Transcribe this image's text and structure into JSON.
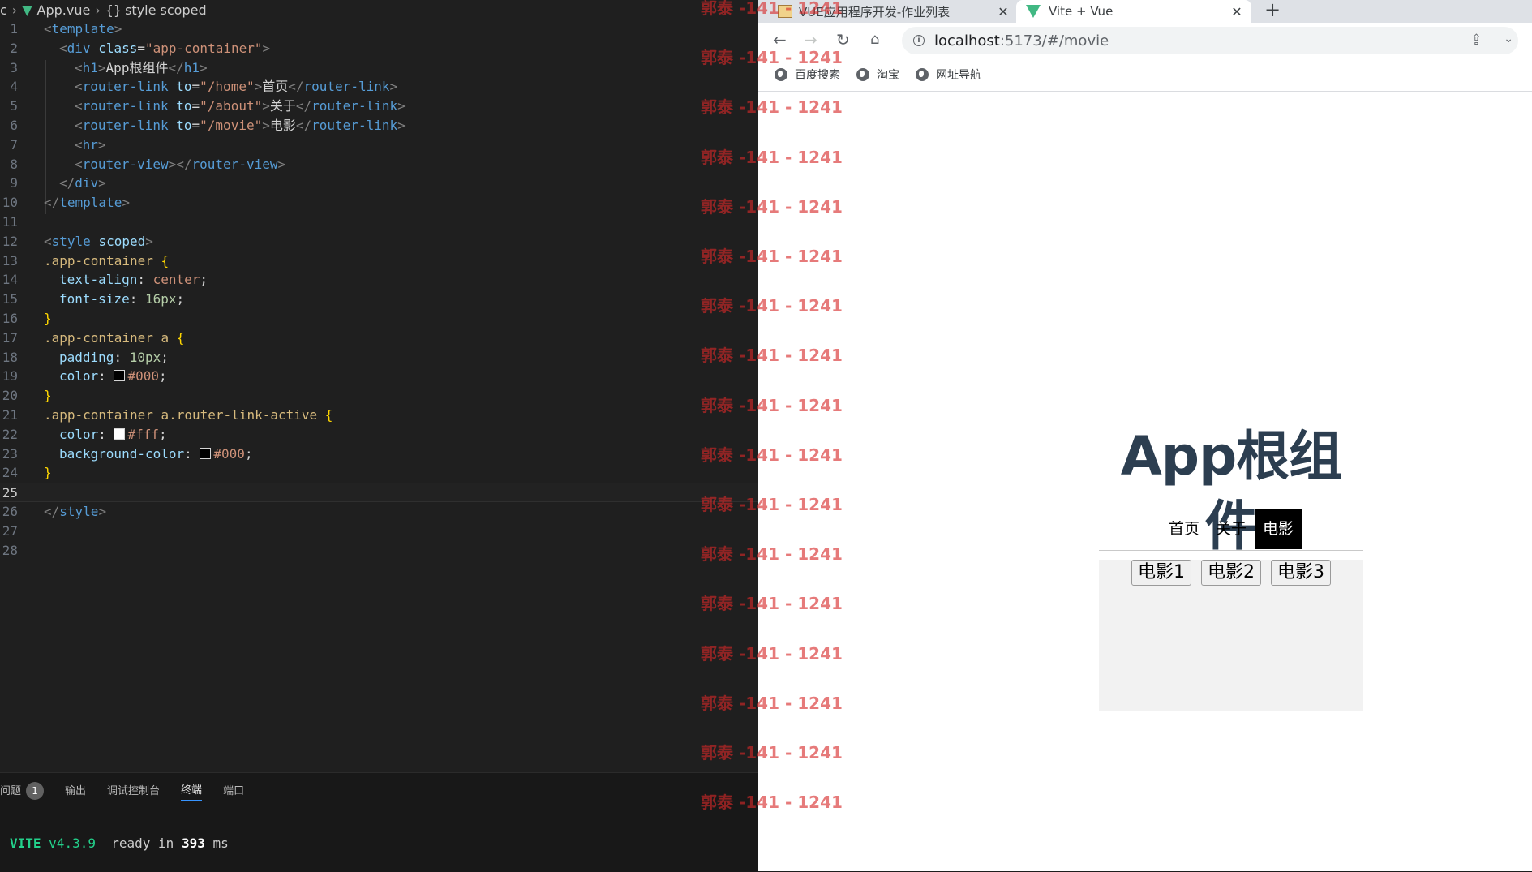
{
  "editor": {
    "breadcrumb": {
      "prefix": "c",
      "file": "App.vue",
      "symbol_glyph": "{}",
      "symbol": "style scoped"
    },
    "current_line": 25,
    "lines": [
      {
        "n": "1"
      },
      {
        "n": "2"
      },
      {
        "n": "3"
      },
      {
        "n": "4"
      },
      {
        "n": "5"
      },
      {
        "n": "6"
      },
      {
        "n": "7"
      },
      {
        "n": "8"
      },
      {
        "n": "9"
      },
      {
        "n": "10"
      },
      {
        "n": "11"
      },
      {
        "n": "12"
      },
      {
        "n": "13"
      },
      {
        "n": "14"
      },
      {
        "n": "15"
      },
      {
        "n": "16"
      },
      {
        "n": "17"
      },
      {
        "n": "18"
      },
      {
        "n": "19"
      },
      {
        "n": "20"
      },
      {
        "n": "21"
      },
      {
        "n": "22"
      },
      {
        "n": "23"
      },
      {
        "n": "24"
      },
      {
        "n": "25"
      },
      {
        "n": "26"
      },
      {
        "n": "27"
      },
      {
        "n": "28"
      }
    ],
    "code": {
      "l1": {
        "open": "<",
        "tag": "template",
        "close": ">"
      },
      "l2": {
        "open": "<",
        "tag": "div",
        "attr": "class",
        "eq": "=",
        "val": "\"app-container\"",
        "close": ">"
      },
      "l3": {
        "open": "<",
        "tag": "h1",
        "close": ">",
        "text": "App根组件",
        "endopen": "</",
        "endtag": "h1",
        "endclose": ">"
      },
      "l4": {
        "open": "<",
        "tag": "router-link",
        "attr": "to",
        "eq": "=",
        "val": "\"/home\"",
        "close": ">",
        "text": "首页",
        "endopen": "</",
        "endtag": "router-link",
        "endclose": ">"
      },
      "l5": {
        "open": "<",
        "tag": "router-link",
        "attr": "to",
        "eq": "=",
        "val": "\"/about\"",
        "close": ">",
        "text": "关于",
        "endopen": "</",
        "endtag": "router-link",
        "endclose": ">"
      },
      "l6": {
        "open": "<",
        "tag": "router-link",
        "attr": "to",
        "eq": "=",
        "val": "\"/movie\"",
        "close": ">",
        "text": "电影",
        "endopen": "</",
        "endtag": "router-link",
        "endclose": ">"
      },
      "l7": {
        "open": "<",
        "tag": "hr",
        "close": ">"
      },
      "l8": {
        "open": "<",
        "tag": "router-view",
        "close": ">",
        "endopen": "</",
        "endtag": "router-view",
        "endclose": ">"
      },
      "l9": {
        "endopen": "</",
        "endtag": "div",
        "endclose": ">"
      },
      "l10": {
        "endopen": "</",
        "endtag": "template",
        "endclose": ">"
      },
      "l12": {
        "open": "<",
        "tag": "style",
        "attr": "scoped",
        "close": ">"
      },
      "l13": {
        "sel": ".app-container",
        "brace": "{"
      },
      "l14": {
        "prop": "text-align",
        "colon": ":",
        "val": "center",
        "semi": ";"
      },
      "l15": {
        "prop": "font-size",
        "colon": ":",
        "val": "16px",
        "semi": ";"
      },
      "l16": {
        "brace": "}"
      },
      "l17": {
        "sel": ".app-container a",
        "brace": "{"
      },
      "l18": {
        "prop": "padding",
        "colon": ":",
        "val": "10px",
        "semi": ";"
      },
      "l19": {
        "prop": "color",
        "colon": ":",
        "val": "#000",
        "semi": ";",
        "swatch": "#000000"
      },
      "l20": {
        "brace": "}"
      },
      "l21": {
        "sel": ".app-container a.router-link-active",
        "brace": "{"
      },
      "l22": {
        "prop": "color",
        "colon": ":",
        "val": "#fff",
        "semi": ";",
        "swatch": "#ffffff"
      },
      "l23": {
        "prop": "background-color",
        "colon": ":",
        "val": "#000",
        "semi": ";",
        "swatch": "#000000"
      },
      "l24": {
        "brace": "}"
      },
      "l26": {
        "endopen": "</",
        "endtag": "style",
        "endclose": ">"
      }
    }
  },
  "panel": {
    "tabs": [
      {
        "label": "问题",
        "badge": "1"
      },
      {
        "label": "输出"
      },
      {
        "label": "调试控制台"
      },
      {
        "label": "终端",
        "active": true
      },
      {
        "label": "端口"
      }
    ],
    "terminal": {
      "vite": "VITE",
      "version": "v4.3.9",
      "ready": "ready in",
      "ms_value": "393",
      "ms_unit": "ms"
    }
  },
  "browser": {
    "tabs": [
      {
        "title": "VUE应用程序开发-作业列表",
        "close": "✕"
      },
      {
        "title": "Vite + Vue",
        "close": "✕"
      }
    ],
    "new_tab": "+",
    "url": {
      "host": "localhost",
      "path": ":5173/#/movie"
    },
    "nav_glyphs": {
      "back": "←",
      "forward": "→",
      "reload": "↻",
      "home": "⌂",
      "info": "i",
      "share": "⇪",
      "more": "⌄"
    },
    "bookmarks": [
      {
        "label": "百度搜索",
        "icon": "globe-icon"
      },
      {
        "label": "淘宝",
        "icon": "globe-icon"
      },
      {
        "label": "网址导航",
        "icon": "globe-icon"
      }
    ]
  },
  "page": {
    "title": "App根组件",
    "nav": [
      {
        "label": "首页"
      },
      {
        "label": "关于"
      },
      {
        "label": "电影",
        "active": true
      }
    ],
    "movies": [
      {
        "label": "电影1"
      },
      {
        "label": "电影2"
      },
      {
        "label": "电影3"
      }
    ]
  },
  "watermark": {
    "text": "郭泰 -141 - 1241",
    "count": 17
  }
}
